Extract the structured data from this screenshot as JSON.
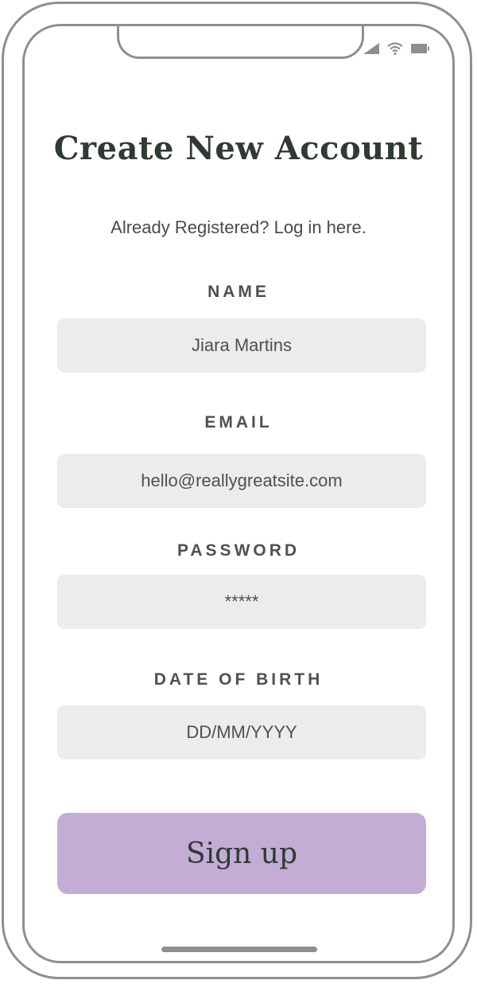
{
  "status_bar": {
    "icons": [
      "signal-icon",
      "wifi-icon",
      "battery-icon"
    ]
  },
  "page": {
    "title": "Create New Account",
    "login_prompt": "Already Registered? Log in here."
  },
  "form": {
    "name": {
      "label": "NAME",
      "value": "Jiara Martins"
    },
    "email": {
      "label": "EMAIL",
      "value": "hello@reallygreatsite.com"
    },
    "password": {
      "label": "PASSWORD",
      "value": "*****"
    },
    "dob": {
      "label": "DATE OF BIRTH",
      "placeholder": "DD/MM/YYYY"
    }
  },
  "actions": {
    "signup_label": "Sign up"
  },
  "colors": {
    "title_text": "#2f3b32",
    "input_background": "#ececec",
    "button_background": "#c3add5",
    "frame": "#8f8f8f"
  }
}
